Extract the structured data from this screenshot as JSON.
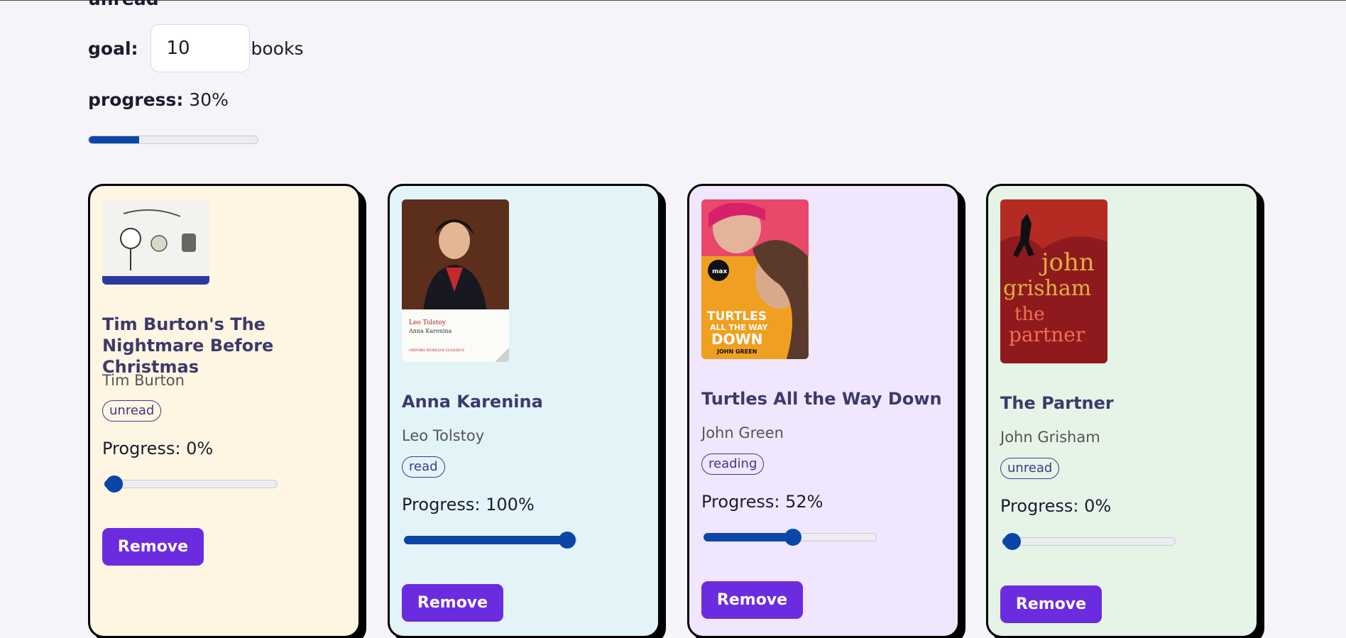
{
  "header": {
    "cut_label": "unread",
    "goal_label": "goal:",
    "goal_value": "10",
    "goal_unit": "books",
    "progress_label": "progress:",
    "progress_value": "30%",
    "progress_fraction": 0.3
  },
  "colors": {
    "accent": "#0a46a8",
    "button": "#6b2ce0",
    "card_bg": [
      "#fff5e3",
      "#e3f4f9",
      "#f0e6fd",
      "#e6f4e8"
    ]
  },
  "books": [
    {
      "title": "Tim Burton's The Nightmare Before Christmas",
      "author": "Tim Burton",
      "status": "unread",
      "progress_text": "Progress: 0%",
      "progress": 0,
      "remove_label": "Remove",
      "cover_icon": "nightmare-before-christmas-cover"
    },
    {
      "title": "Anna Karenina",
      "author": "Leo Tolstoy",
      "status": "read",
      "progress_text": "Progress: 100%",
      "progress": 100,
      "remove_label": "Remove",
      "cover_icon": "anna-karenina-cover",
      "cover_text": [
        "Leo Tolstoy",
        "Anna Karenina",
        "OXFORD WORLD'S CLASSICS"
      ]
    },
    {
      "title": "Turtles All the Way Down",
      "author": "John Green",
      "status": "reading",
      "progress_text": "Progress: 52%",
      "progress": 52,
      "remove_label": "Remove",
      "cover_icon": "turtles-all-the-way-down-cover",
      "cover_text": [
        "TURTLES",
        "ALL THE WAY",
        "DOWN",
        "JOHN GREEN",
        "max"
      ]
    },
    {
      "title": "The Partner",
      "author": "John Grisham",
      "status": "unread",
      "progress_text": "Progress: 0%",
      "progress": 0,
      "remove_label": "Remove",
      "cover_icon": "the-partner-cover",
      "cover_text": [
        "john",
        "grisham",
        "the",
        "partner"
      ]
    }
  ]
}
